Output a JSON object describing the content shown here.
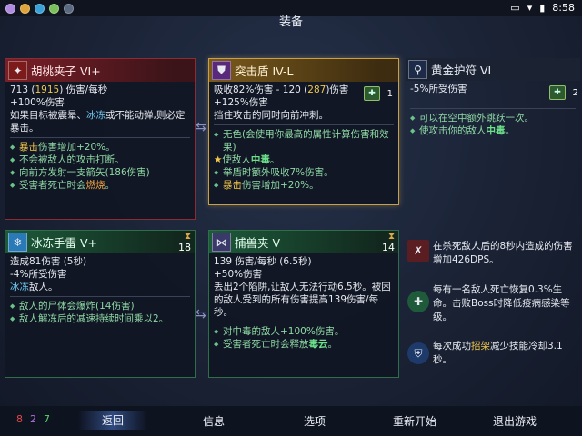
{
  "status_bar": {
    "time": "8:58"
  },
  "page_title": "装备",
  "cards": {
    "walnut": {
      "name": "胡桃夹子 VI+",
      "line1_a": "713 (",
      "line1_b": "1915",
      "line1_c": ") 伤害/每秒",
      "line2": "+100%伤害",
      "desc_a": "如果目标被震晕、",
      "desc_b": "冰冻",
      "desc_c": "或不能动弹,则必定",
      "desc2": "暴击。",
      "bullets": [
        {
          "hl": "暴击",
          "rest": "伤害增加+20%。"
        },
        {
          "hl": "",
          "rest": "不会被敌人的攻击打断。"
        },
        {
          "hl": "",
          "rest": "向前方发射一支箭矢(186伤害)"
        },
        {
          "hl_pre": "受害者死亡时会",
          "hl": "燃烧",
          "rest": "。"
        }
      ]
    },
    "shield": {
      "name": "突击盾 IV-L",
      "line1_a": "吸收82%伤害 - 120 (",
      "line1_b": "287",
      "line1_c": ")伤害",
      "line2": "+125%伤害",
      "desc": "挡住攻击的同时向前冲刺。",
      "scroll_count": "1",
      "bullets": [
        {
          "text": "无色(会使用你最高的属性计算伤害和效"
        },
        {
          "text": "果)"
        },
        {
          "star": "★",
          "pre": "使敌人",
          "hl": "中毒",
          "rest": "。"
        },
        {
          "text": "举盾时额外吸收7%伤害。"
        },
        {
          "hl": "暴击",
          "rest": "伤害增加+20%。"
        }
      ]
    },
    "amulet": {
      "name": "黄金护符 VI",
      "line1": "-5%所受伤害",
      "scroll_count": "2",
      "bullets": [
        {
          "text": "可以在空中额外跳跃一次。"
        },
        {
          "pre": "使攻击你的敌人",
          "hl": "中毒",
          "rest": "。"
        }
      ]
    },
    "grenade": {
      "name": "冰冻手雷 V+",
      "cooldown": "18",
      "line1": "造成81伤害 (5秒)",
      "line2": "-4%所受伤害",
      "desc_a": "冰冻",
      "desc_b": "敌人。",
      "bullets": [
        {
          "text": "敌人的尸体会爆炸(14伤害)"
        },
        {
          "text": "敌人解冻后的减速持续时间乘以2。"
        }
      ]
    },
    "trap": {
      "name": "捕兽夹 V",
      "cooldown": "14",
      "line1": "139 伤害/每秒 (6.5秒)",
      "line2": "+50%伤害",
      "desc1": "丢出2个陷阱,让敌人无法行动6.5秒。被困",
      "desc2": "的敌人受到的所有伤害提高139伤害/每",
      "desc3": "秒。",
      "bullets": [
        {
          "text": "对中毒的敌人+100%伤害。"
        },
        {
          "pre": "受害者死亡时会释放",
          "hl": "毒云",
          "rest": "。"
        }
      ]
    }
  },
  "mutations": [
    {
      "icon": "kill-dps-icon",
      "text": "在杀死敌人后的8秒内造成的伤害增加426DPS。"
    },
    {
      "icon": "heal-icon",
      "text": "每有一名敌人死亡恢复0.3%生命。击败Boss时降低疫病感染等级。"
    },
    {
      "icon": "parry-icon",
      "pre": "每次成功",
      "hl": "招架",
      "rest": "减少技能冷却3.1秒。"
    }
  ],
  "bottom": {
    "cells_red": "8",
    "cells_purple": "2",
    "cells_green": "7",
    "back": "返回",
    "info": "信息",
    "options": "选项",
    "restart": "重新开始",
    "quit": "退出游戏"
  },
  "colors": {
    "accent_gold": "#c9a04a",
    "red": "#8c2b34",
    "green": "#2f6e4a"
  }
}
